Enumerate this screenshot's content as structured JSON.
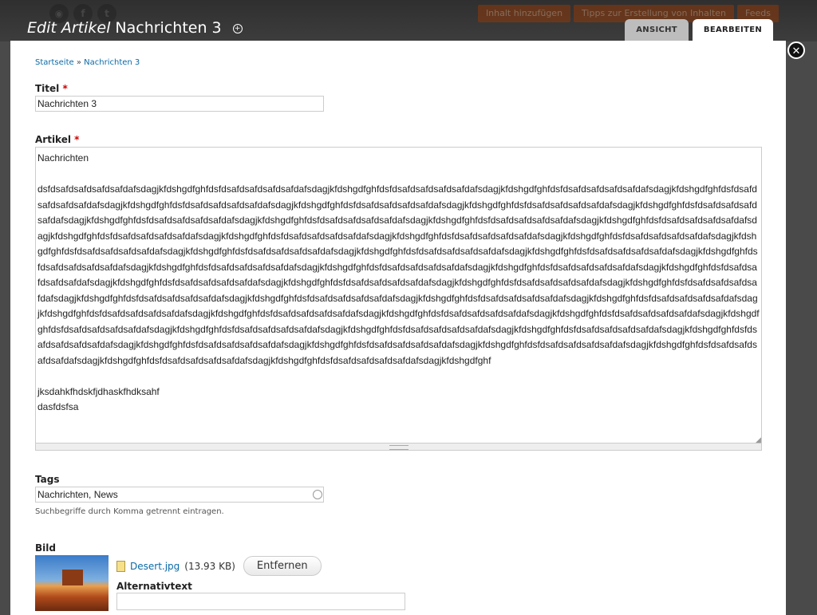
{
  "backdrop": {
    "social_icons": [
      "rss-icon",
      "facebook-icon",
      "twitter-icon"
    ],
    "links": [
      "Inhalt hinzufügen",
      "Tipps zur Erstellung von Inhalten",
      "Feeds"
    ]
  },
  "header": {
    "title_prefix": "Edit Artikel",
    "title_name": "Nachrichten 3"
  },
  "tabs": [
    {
      "label": "ANSICHT",
      "active": false
    },
    {
      "label": "BEARBEITEN",
      "active": true
    }
  ],
  "breadcrumb": {
    "home": "Startseite",
    "separator": "»",
    "current": "Nachrichten 3"
  },
  "form": {
    "title": {
      "label": "Titel",
      "required_mark": "*",
      "value": "Nachrichten 3"
    },
    "article": {
      "label": "Artikel",
      "required_mark": "*",
      "line1": "Nachrichten",
      "body": "dsfdsafdsafdsafdsafdafsdagjkfdshgdfghfdsfdsafdsafdsafdsafdafsdagjkfdshgdfghfdsfdsafdsafdsafdsafdafsdagjkfdshgdfghfdsfdsafdsafdsafdsafdafsdagjkfdshgdfghfdsfdsafdsafdsafdsafdafsdagjkfdshgdfghfdsfdsafdsafdsafdsafdafsdagjkfdshgdfghfdsfdsafdsafdsafdsafdafsdagjkfdshgdfghfdsfdsafdsafdsafdsafdafsdagjkfdshgdfghfdsfdsafdsafdsafdsafdafsdagjkfdshgdfghfdsfdsafdsafdsafdsafdafsdagjkfdshgdfghfdsfdsafdsafdsafdsafdafsdagjkfdshgdfghfdsfdsafdsafdsafdsafdafsdagjkfdshgdfghfdsfdsafdsafdsafdsafdafsdagjkfdshgdfghfdsfdsafdsafdsafdsafdafsdagjkfdshgdfghfdsfdsafdsafdsafdsafdafsdagjkfdshgdfghfdsfdsafdsafdsafdsafdafsdagjkfdshgdfghfdsfdsafdsafdsafdsafdafsdagjkfdshgdfghfdsfdsafdsafdsafdsafdafsdagjkfdshgdfghfdsfdsafdsafdsafdsafdafsdagjkfdshgdfghfdsfdsafdsafdsafdsafdafsdagjkfdshgdfghfdsfdsafdsafdsafdsafdafsdagjkfdshgdfghfdsfdsafdsafdsafdsafdafsdagjkfdshgdfghfdsfdsafdsafdsafdsafdafsdagjkfdshgdfghfdsfdsafdsafdsafdsafdafsdagjkfdshgdfghfdsfdsafdsafdsafdsafdafsdagjkfdshgdfghfdsfdsafdsafdsafdsafdafsdagjkfdshgdfghfdsfdsafdsafdsafdsafdafsdagjkfdshgdfghfdsfdsafdsafdsafdsafdafsdagjkfdshgdfghfdsfdsafdsafdsafdsafdafsdagjkfdshgdfghfdsfdsafdsafdsafdsafdafsdagjkfdshgdfghfdsfdsafdsafdsafdsafdafsdagjkfdshgdfghfdsfdsafdsafdsafdsafdafsdagjkfdshgdfghfdsfdsafdsafdsafdsafdafsdagjkfdshgdfghfdsfdsafdsafdsafdsafdafsdagjkfdshgdfghfdsfdsafdsafdsafdsafdafsdagjkfdshgdfghfdsfdsafdsafdsafdsafdafsdagjkfdshgdfghfdsfdsafdsafdsafdsafdafsdagjkfdshgdfghfdsfdsafdsafdsafdsafdafsdagjkfdshgdfghfdsfdsafdsafdsafdsafdafsdagjkfdshgdfghfdsfdsafdsafdsafdsafdafsdagjkfdshgdfghfdsfdsafdsafdsafdsafdafsdagjkfdshgdfghfdsfdsafdsafdsafdsafdafsdagjkfdshgdfghfdsfdsafdsafdsafdsafdafsdagjkfdshgdfghfdsfdsafdsafdsafdsafdafsdagjkfdshgdfghfdsfdsafdsafdsafdsafdafsdagjkfdshgdfghfdsfdsafdsafdsafdsafdafsdagjkfdshgdfghfdsfdsafdsafdsafdsafdafsdagjkfdshgdfghfdsfdsafdsafdsafdsafdafsdagjkfdshgdfghfdsfdsafdsafdsafdsafdafsdagjkfdshgdfghf",
      "line3": "jksdahkfhdskfjdhaskfhdksahf",
      "line4": "dasfdsfsa"
    },
    "tags": {
      "label": "Tags",
      "value": "Nachrichten, News",
      "help": "Suchbegriffe durch Komma getrennt eintragen."
    },
    "image": {
      "label": "Bild",
      "file_name": "Desert.jpg",
      "file_size": "(13.93 KB)",
      "remove_label": "Entfernen",
      "alt_label": "Alternativtext",
      "alt_value": ""
    }
  }
}
